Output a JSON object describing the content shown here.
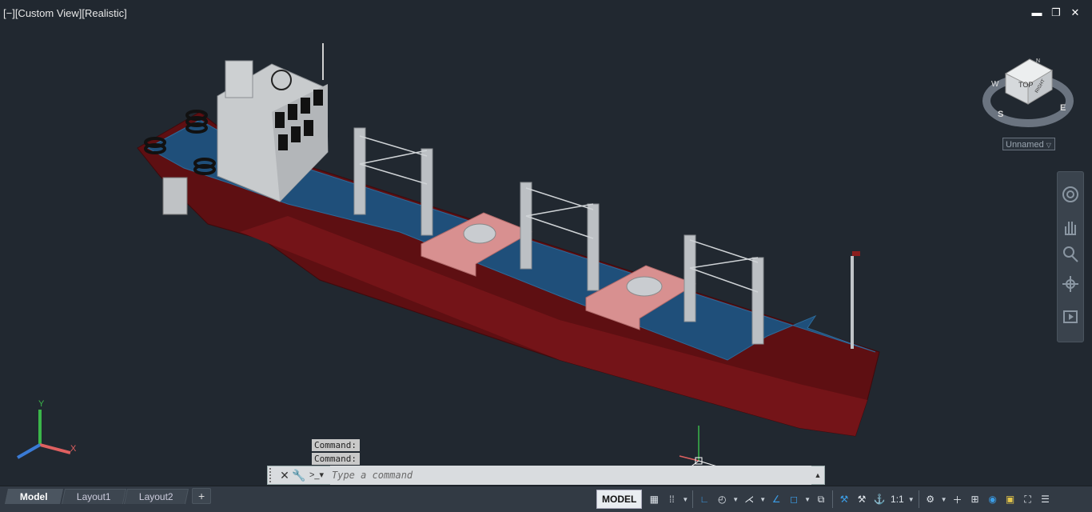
{
  "viewport": {
    "controls_label": "[−][Custom View][Realistic]",
    "view_name": "Unnamed",
    "viewcube": {
      "top": "TOP",
      "right": "RIGHT",
      "compass": [
        "W",
        "S",
        "E",
        "N"
      ]
    }
  },
  "window": {
    "minimize": "▬",
    "restore": "❐",
    "close": "✕"
  },
  "ucs": {
    "x_label": "X",
    "y_label": "Y"
  },
  "command": {
    "history": [
      "Command:",
      "Command:"
    ],
    "placeholder": "Type a command"
  },
  "tabs": [
    {
      "label": "Model",
      "active": true
    },
    {
      "label": "Layout1",
      "active": false
    },
    {
      "label": "Layout2",
      "active": false
    }
  ],
  "tab_add": "+",
  "statusbar": {
    "model_label": "MODEL",
    "scale_label": "1:1"
  },
  "colors": {
    "background": "#212830",
    "hull": "#6b1114",
    "deck": "#1f4f7a",
    "hatch": "#d89090",
    "accent": "#3b9de6"
  }
}
